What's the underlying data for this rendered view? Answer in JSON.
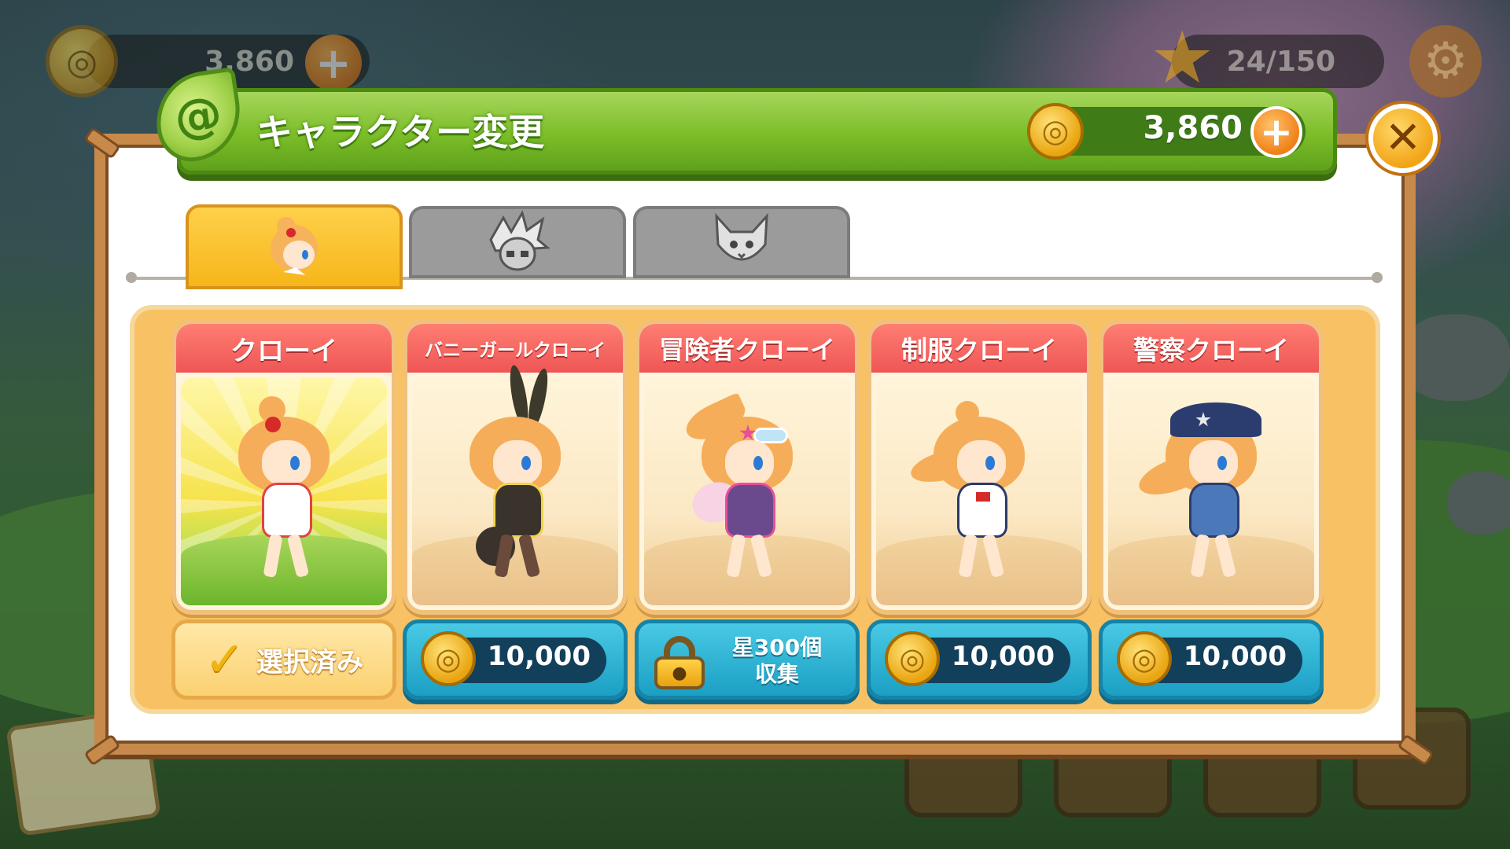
{
  "hud": {
    "coins": "3,860",
    "stars": "24/150",
    "coin_icon": "coin-icon",
    "plus_icon": "plus-icon",
    "star_icon": "star-icon",
    "settings_icon": "gear-icon"
  },
  "dialog": {
    "title": "キャラクター変更",
    "coins": "3,860",
    "close_icon": "close-icon"
  },
  "tabs": [
    {
      "name": "chloe",
      "active": true
    },
    {
      "name": "white-hair-boy",
      "active": false
    },
    {
      "name": "cat",
      "active": false
    }
  ],
  "cards": [
    {
      "name": "クローイ",
      "status": "selected",
      "button_label": "選択済み"
    },
    {
      "name": "バニーガールクローイ",
      "status": "buy",
      "price": "10,000"
    },
    {
      "name": "冒険者クローイ",
      "status": "locked",
      "unlock_line1": "星300個",
      "unlock_line2": "収集"
    },
    {
      "name": "制服クローイ",
      "status": "buy",
      "price": "10,000"
    },
    {
      "name": "警察クローイ",
      "status": "buy",
      "price": "10,000"
    }
  ],
  "colors": {
    "header_green": "#7cbd28",
    "card_header_red": "#ee5656",
    "buy_button_blue": "#1b9fc4",
    "panel_frame": "#c88a4a",
    "tab_active": "#f6b61a"
  }
}
